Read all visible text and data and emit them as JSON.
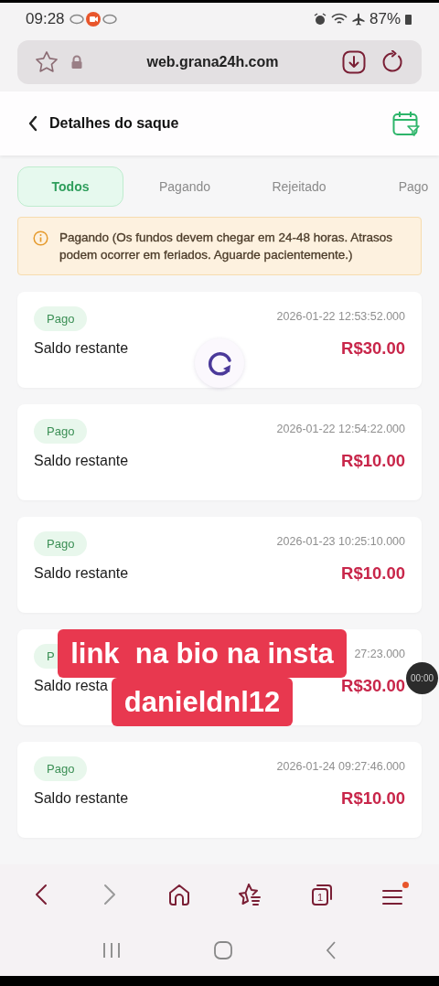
{
  "status_bar": {
    "time": "09:28",
    "battery": "87%"
  },
  "address_bar": {
    "url": "web.grana24h.com"
  },
  "header": {
    "title": "Detalhes do saque"
  },
  "tabs": [
    {
      "label": "Todos",
      "selected": true
    },
    {
      "label": "Pagando",
      "selected": false
    },
    {
      "label": "Rejeitado",
      "selected": false
    },
    {
      "label": "Pago",
      "selected": false
    }
  ],
  "notice": {
    "text": "Pagando (Os fundos devem chegar em 24-48 horas. Atrasos podem ocorrer em feriados. Aguarde pacientemente.)"
  },
  "records": [
    {
      "status": "Pago",
      "timestamp": "2026-01-22 12:53:52.000",
      "label": "Saldo restante",
      "amount": "R$30.00"
    },
    {
      "status": "Pago",
      "timestamp": "2026-01-22 12:54:22.000",
      "label": "Saldo restante",
      "amount": "R$10.00"
    },
    {
      "status": "Pago",
      "timestamp": "2026-01-23 10:25:10.000",
      "label": "Saldo restante",
      "amount": "R$10.00"
    },
    {
      "status": "P",
      "timestamp": "27:23.000",
      "label": "Saldo resta",
      "amount": "R$30.00"
    },
    {
      "status": "Pago",
      "timestamp": "2026-01-24 09:27:46.000",
      "label": "Saldo restante",
      "amount": "R$10.00"
    }
  ],
  "overlay_caption": {
    "lines": [
      "link  na bio na insta",
      "danieldnl12"
    ]
  },
  "recording_timer": "00:00",
  "browser_toolbar": {
    "tab_count": "1",
    "menu_notification": true
  }
}
